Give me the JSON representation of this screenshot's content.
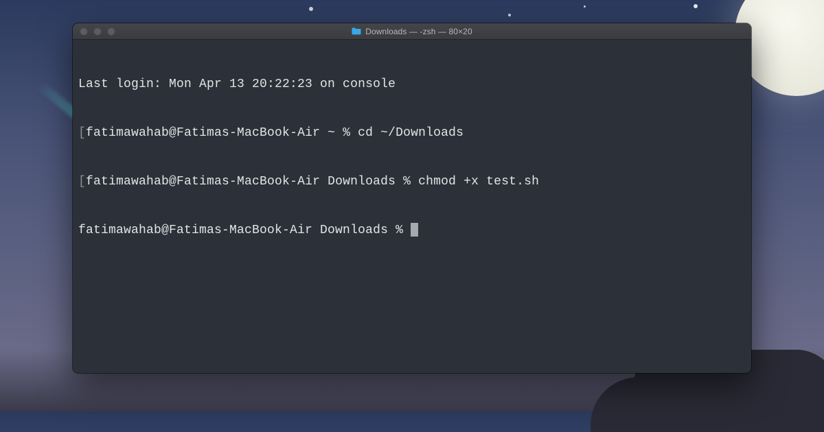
{
  "window": {
    "title": "Downloads — -zsh — 80×20"
  },
  "terminal": {
    "lines": [
      "Last login: Mon Apr 13 20:22:23 on console",
      "fatimawahab@Fatimas-MacBook-Air ~ % cd ~/Downloads",
      "fatimawahab@Fatimas-MacBook-Air Downloads % chmod +x test.sh",
      "fatimawahab@Fatimas-MacBook-Air Downloads % "
    ]
  }
}
